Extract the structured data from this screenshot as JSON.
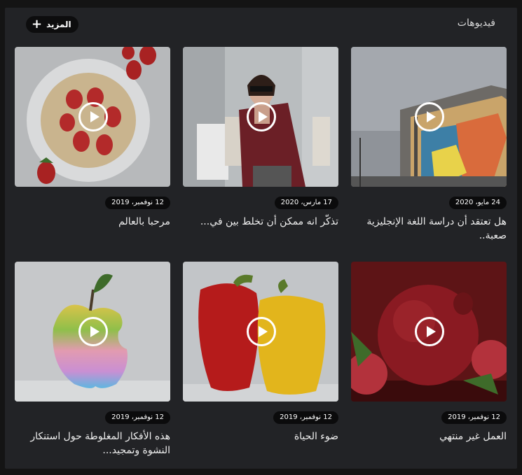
{
  "section": {
    "title": "فيديوهات",
    "more_label": "المزيد",
    "more_icon": "plus-icon"
  },
  "videos": [
    {
      "title": "هل تعتقد أن دراسة اللغة الإنجليزية صعبة..",
      "date": "24 مايو، 2020",
      "icon": "play-icon"
    },
    {
      "title": "تذكّر انه ممكن أن تخلط بين في...",
      "date": "17 مارس، 2020",
      "icon": "play-icon"
    },
    {
      "title": "مرحبا بالعالم",
      "date": "12 نوفمبر، 2019",
      "icon": "play-icon"
    },
    {
      "title": "العمل غير منتهي",
      "date": "12 نوفمبر، 2019",
      "icon": "play-icon"
    },
    {
      "title": "ضوء الحياة",
      "date": "12 نوفمبر، 2019",
      "icon": "play-icon"
    },
    {
      "title": "هذه الأفكار المغلوطة حول استنكار النشوة وتمجيد...",
      "date": "12 نوفمبر، 2019",
      "icon": "play-icon"
    }
  ]
}
